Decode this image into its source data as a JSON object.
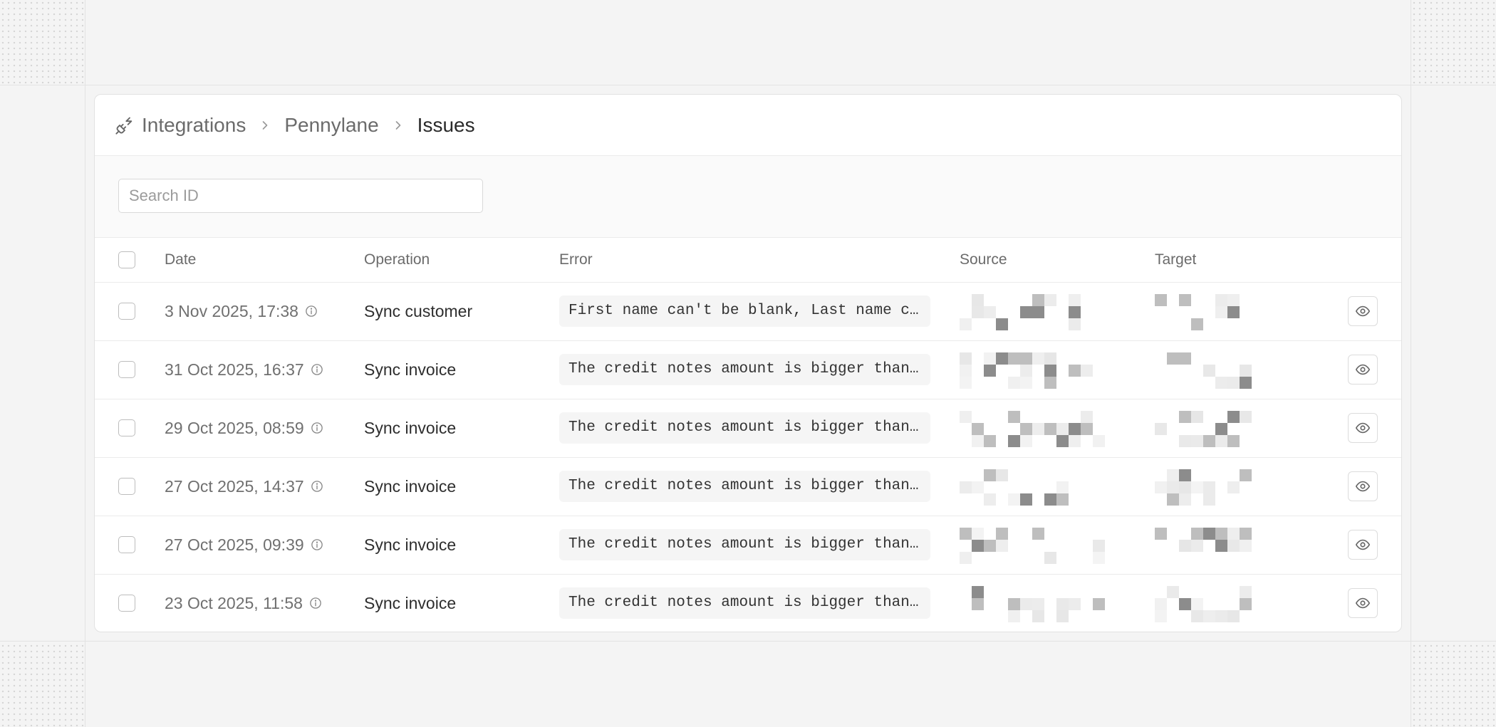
{
  "breadcrumb": {
    "icon": "plug-icon",
    "items": [
      "Integrations",
      "Pennylane",
      "Issues"
    ]
  },
  "search": {
    "placeholder": "Search ID",
    "value": ""
  },
  "table": {
    "headers": {
      "date": "Date",
      "operation": "Operation",
      "error": "Error",
      "source": "Source",
      "target": "Target"
    },
    "rows": [
      {
        "date": "3 Nov 2025, 17:38",
        "operation": "Sync customer",
        "error": "First name can't be blank, Last name can't be blank"
      },
      {
        "date": "31 Oct 2025, 16:37",
        "operation": "Sync invoice",
        "error": "The credit notes amount is bigger than the invoice amount"
      },
      {
        "date": "29 Oct 2025, 08:59",
        "operation": "Sync invoice",
        "error": "The credit notes amount is bigger than the invoice amount"
      },
      {
        "date": "27 Oct 2025, 14:37",
        "operation": "Sync invoice",
        "error": "The credit notes amount is bigger than the invoice amount"
      },
      {
        "date": "27 Oct 2025, 09:39",
        "operation": "Sync invoice",
        "error": "The credit notes amount is bigger than the invoice amount"
      },
      {
        "date": "23 Oct 2025, 11:58",
        "operation": "Sync invoice",
        "error": "The credit notes amount is bigger than the invoice amount"
      }
    ]
  },
  "colors": {
    "accent_text": "#2a2a2a",
    "muted_text": "#6b6b6b",
    "border": "#e2e2e2",
    "redaction": "#8c8c8c"
  }
}
